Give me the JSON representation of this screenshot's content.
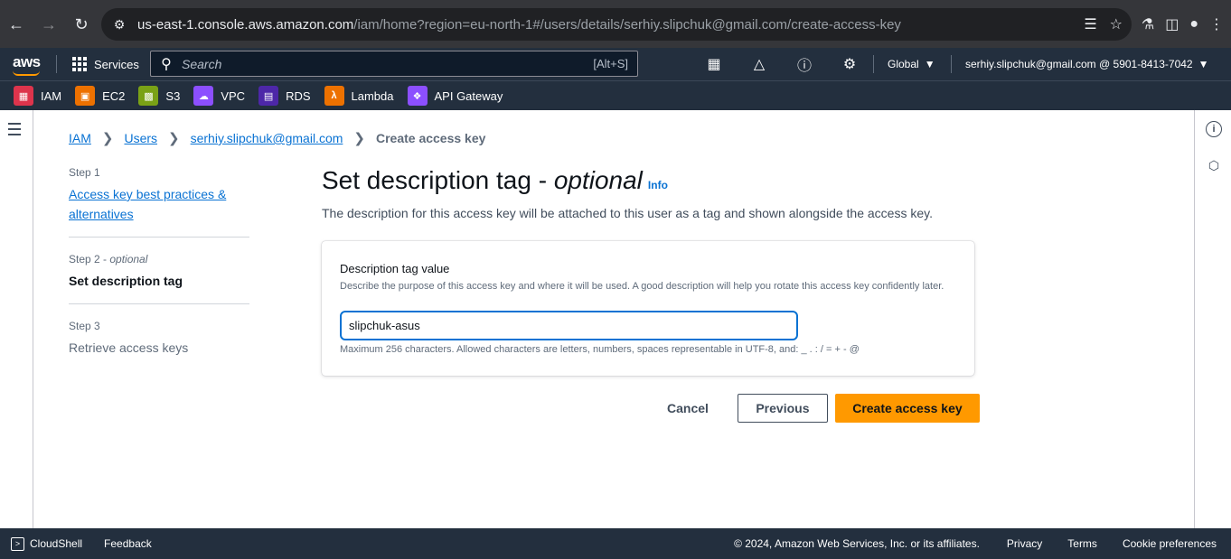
{
  "browser": {
    "url_host": "us-east-1.console.aws.amazon.com",
    "url_path": "/iam/home?region=eu-north-1#/users/details/serhiy.slipchuk@gmail.com/create-access-key",
    "icons": [
      "back-icon",
      "forward-icon",
      "reload-icon",
      "site-info-icon",
      "translate-icon",
      "star-icon",
      "labs-icon",
      "sidepanel-icon",
      "profile-icon",
      "menu-icon"
    ]
  },
  "aws_nav": {
    "services_label": "Services",
    "search_placeholder": "Search",
    "search_shortcut": "[Alt+S]",
    "region": "Global",
    "account": "serhiy.slipchuk@gmail.com @ 5901-8413-7042"
  },
  "favorites": [
    {
      "label": "IAM",
      "color": "#dd344c"
    },
    {
      "label": "EC2",
      "color": "#ed7100"
    },
    {
      "label": "S3",
      "color": "#7aa116"
    },
    {
      "label": "VPC",
      "color": "#8c4fff"
    },
    {
      "label": "RDS",
      "color": "#4d27a8"
    },
    {
      "label": "Lambda",
      "color": "#ed7100"
    },
    {
      "label": "API Gateway",
      "color": "#8c4fff"
    }
  ],
  "breadcrumb": {
    "items": [
      "IAM",
      "Users",
      "serhiy.slipchuk@gmail.com"
    ],
    "current": "Create access key"
  },
  "steps": [
    {
      "label": "Step 1",
      "title": "Access key best practices & alternatives",
      "state": "link"
    },
    {
      "label": "Step 2 - ",
      "label_optional": "optional",
      "title": "Set description tag",
      "state": "active"
    },
    {
      "label": "Step 3",
      "title": "Retrieve access keys",
      "state": "disabled"
    }
  ],
  "main": {
    "title": "Set description tag - ",
    "title_optional": "optional",
    "info": "Info",
    "description": "The description for this access key will be attached to this user as a tag and shown alongside the access key."
  },
  "form": {
    "label": "Description tag value",
    "description": "Describe the purpose of this access key and where it will be used. A good description will help you rotate this access key confidently later.",
    "value": "slipchuk-asus",
    "constraint": "Maximum 256 characters. Allowed characters are letters, numbers, spaces representable in UTF-8, and: _ . : / = + - @"
  },
  "actions": {
    "cancel": "Cancel",
    "previous": "Previous",
    "create": "Create access key"
  },
  "footer": {
    "cloudshell": "CloudShell",
    "feedback": "Feedback",
    "copyright": "© 2024, Amazon Web Services, Inc. or its affiliates.",
    "privacy": "Privacy",
    "terms": "Terms",
    "cookies": "Cookie preferences"
  },
  "colors": {
    "accent": "#0972d3",
    "primary_button": "#ff9900",
    "nav_bg": "#232f3e"
  }
}
